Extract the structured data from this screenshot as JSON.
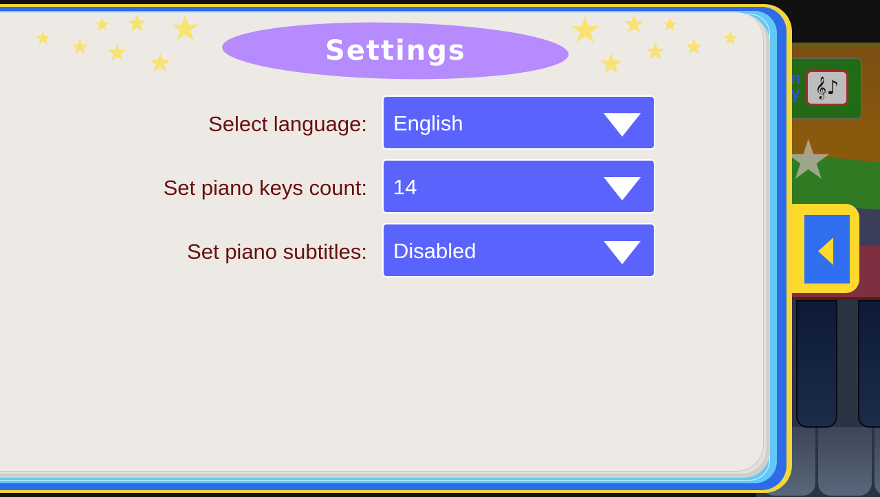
{
  "title": "Settings",
  "settings": {
    "rows": [
      {
        "label": "Select language:",
        "value": "English"
      },
      {
        "label": "Set piano keys count:",
        "value": "14"
      },
      {
        "label": "Set piano subtitles:",
        "value": "Disabled"
      }
    ]
  },
  "background": {
    "panel_text": "n\ny",
    "music_icon": "𝄞♪"
  },
  "colors": {
    "dropdown_bg": "#5a64fd",
    "title_pill": "#b58bfd",
    "label_text": "#6a0d0d",
    "page_bg": "#edeae6",
    "frame_blue": "#2d6ce6",
    "frame_yellow": "#f4d53a"
  },
  "icons": {
    "dropdown_caret": "caret-down-icon",
    "side_toggle": "arrow-left-icon",
    "music": "music-notes-icon",
    "star": "★"
  }
}
